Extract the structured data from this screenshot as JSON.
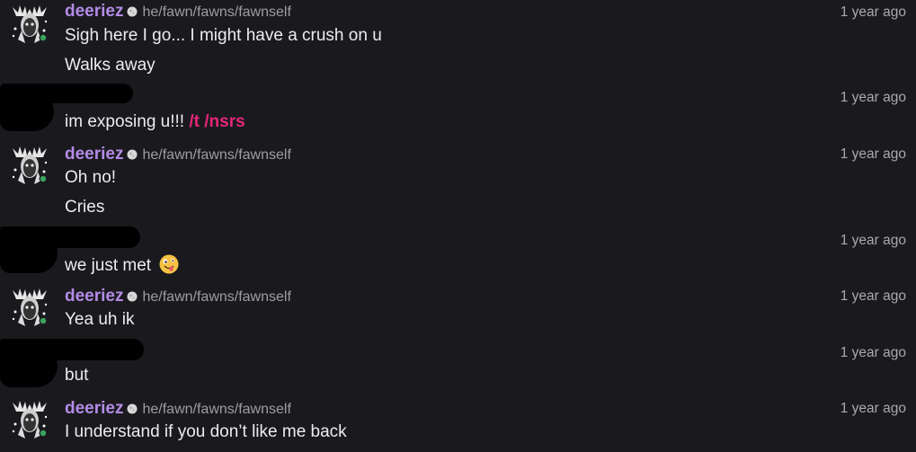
{
  "user": {
    "name": "deeriez",
    "pronouns": "he/fawn/fawns/fawnself",
    "status_color": "#3ba55d"
  },
  "messages": [
    {
      "time": "1 year ago",
      "lines": [
        "Sigh here I go... I might have a crush on u",
        "Walks away"
      ]
    },
    {
      "time": "1 year ago",
      "text": "im exposing u!!!",
      "link": "/t /nsrs"
    },
    {
      "time": "1 year ago",
      "lines": [
        "Oh no!",
        "Cries"
      ]
    },
    {
      "time": "1 year ago",
      "text": "we just met",
      "emoji": "zany-face-emoji"
    },
    {
      "time": "1 year ago",
      "lines": [
        "Yea uh ik"
      ]
    },
    {
      "time": "1 year ago",
      "text": "but"
    },
    {
      "time": "1 year ago",
      "lines": [
        "I understand if you don’t like me back"
      ]
    }
  ],
  "colors": {
    "background": "#1a1a1e",
    "username": "#b38be6",
    "link": "#e6267a",
    "muted": "#9c9ca3"
  }
}
